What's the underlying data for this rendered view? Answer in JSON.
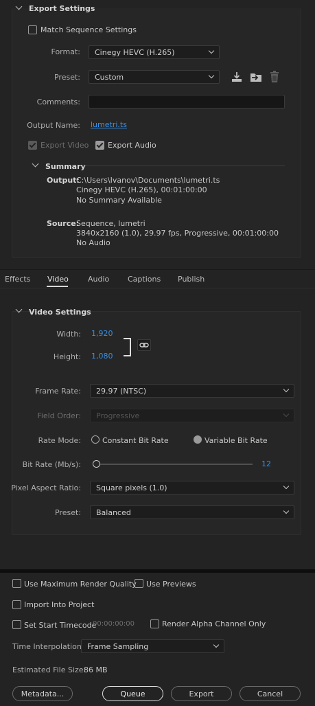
{
  "export_settings": {
    "title": "Export Settings",
    "match_sequence_label": "Match Sequence Settings",
    "format_label": "Format:",
    "format_value": "Cinegy HEVC (H.265)",
    "preset_label": "Preset:",
    "preset_value": "Custom",
    "comments_label": "Comments:",
    "comments_value": "",
    "output_name_label": "Output Name:",
    "output_name_value": "lumetri.ts",
    "export_video_label": "Export Video",
    "export_audio_label": "Export Audio"
  },
  "summary": {
    "title": "Summary",
    "output_label": "Output:",
    "output_lines": [
      "C:\\Users\\Ivanov\\Documents\\lumetri.ts",
      "Cinegy HEVC (H.265), 00:01:00:00",
      "No Summary Available"
    ],
    "source_label": "Source:",
    "source_lines": [
      "Sequence, lumetri",
      "3840x2160 (1.0), 29.97 fps, Progressive, 00:01:00:00",
      "No Audio"
    ]
  },
  "tabs": [
    "Effects",
    "Video",
    "Audio",
    "Captions",
    "Publish"
  ],
  "video_settings": {
    "title": "Video Settings",
    "width_label": "Width:",
    "width_value": "1,920",
    "height_label": "Height:",
    "height_value": "1,080",
    "frame_rate_label": "Frame Rate:",
    "frame_rate_value": "29.97 (NTSC)",
    "field_order_label": "Field Order:",
    "field_order_value": "Progressive",
    "rate_mode_label": "Rate Mode:",
    "rate_mode_cbr": "Constant Bit Rate",
    "rate_mode_vbr": "Variable Bit Rate",
    "bit_rate_label": "Bit Rate (Mb/s):",
    "bit_rate_value": "12",
    "par_label": "Pixel Aspect Ratio:",
    "par_value": "Square pixels (1.0)",
    "preset_label": "Preset:",
    "preset_value": "Balanced"
  },
  "footer": {
    "max_render_label": "Use Maximum Render Quality",
    "use_previews_label": "Use Previews",
    "import_label": "Import Into Project",
    "start_tc_label": "Set Start Timecode",
    "start_tc_value": "00:00:00:00",
    "render_alpha_label": "Render Alpha Channel Only",
    "time_interp_label": "Time Interpolation:",
    "time_interp_value": "Frame Sampling",
    "file_size_label": "Estimated File Size:",
    "file_size_value": "86 MB",
    "metadata_btn": "Metadata...",
    "queue_btn": "Queue",
    "export_btn": "Export",
    "cancel_btn": "Cancel"
  }
}
